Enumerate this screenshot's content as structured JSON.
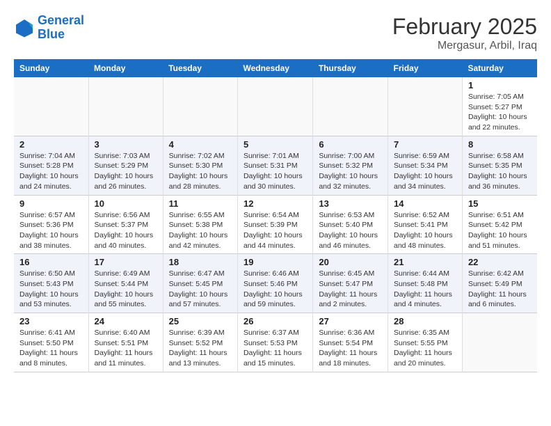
{
  "logo": {
    "line1": "General",
    "line2": "Blue"
  },
  "title": "February 2025",
  "subtitle": "Mergasur, Arbil, Iraq",
  "days_of_week": [
    "Sunday",
    "Monday",
    "Tuesday",
    "Wednesday",
    "Thursday",
    "Friday",
    "Saturday"
  ],
  "weeks": [
    [
      {
        "day": "",
        "info": ""
      },
      {
        "day": "",
        "info": ""
      },
      {
        "day": "",
        "info": ""
      },
      {
        "day": "",
        "info": ""
      },
      {
        "day": "",
        "info": ""
      },
      {
        "day": "",
        "info": ""
      },
      {
        "day": "1",
        "info": "Sunrise: 7:05 AM\nSunset: 5:27 PM\nDaylight: 10 hours and 22 minutes."
      }
    ],
    [
      {
        "day": "2",
        "info": "Sunrise: 7:04 AM\nSunset: 5:28 PM\nDaylight: 10 hours and 24 minutes."
      },
      {
        "day": "3",
        "info": "Sunrise: 7:03 AM\nSunset: 5:29 PM\nDaylight: 10 hours and 26 minutes."
      },
      {
        "day": "4",
        "info": "Sunrise: 7:02 AM\nSunset: 5:30 PM\nDaylight: 10 hours and 28 minutes."
      },
      {
        "day": "5",
        "info": "Sunrise: 7:01 AM\nSunset: 5:31 PM\nDaylight: 10 hours and 30 minutes."
      },
      {
        "day": "6",
        "info": "Sunrise: 7:00 AM\nSunset: 5:32 PM\nDaylight: 10 hours and 32 minutes."
      },
      {
        "day": "7",
        "info": "Sunrise: 6:59 AM\nSunset: 5:34 PM\nDaylight: 10 hours and 34 minutes."
      },
      {
        "day": "8",
        "info": "Sunrise: 6:58 AM\nSunset: 5:35 PM\nDaylight: 10 hours and 36 minutes."
      }
    ],
    [
      {
        "day": "9",
        "info": "Sunrise: 6:57 AM\nSunset: 5:36 PM\nDaylight: 10 hours and 38 minutes."
      },
      {
        "day": "10",
        "info": "Sunrise: 6:56 AM\nSunset: 5:37 PM\nDaylight: 10 hours and 40 minutes."
      },
      {
        "day": "11",
        "info": "Sunrise: 6:55 AM\nSunset: 5:38 PM\nDaylight: 10 hours and 42 minutes."
      },
      {
        "day": "12",
        "info": "Sunrise: 6:54 AM\nSunset: 5:39 PM\nDaylight: 10 hours and 44 minutes."
      },
      {
        "day": "13",
        "info": "Sunrise: 6:53 AM\nSunset: 5:40 PM\nDaylight: 10 hours and 46 minutes."
      },
      {
        "day": "14",
        "info": "Sunrise: 6:52 AM\nSunset: 5:41 PM\nDaylight: 10 hours and 48 minutes."
      },
      {
        "day": "15",
        "info": "Sunrise: 6:51 AM\nSunset: 5:42 PM\nDaylight: 10 hours and 51 minutes."
      }
    ],
    [
      {
        "day": "16",
        "info": "Sunrise: 6:50 AM\nSunset: 5:43 PM\nDaylight: 10 hours and 53 minutes."
      },
      {
        "day": "17",
        "info": "Sunrise: 6:49 AM\nSunset: 5:44 PM\nDaylight: 10 hours and 55 minutes."
      },
      {
        "day": "18",
        "info": "Sunrise: 6:47 AM\nSunset: 5:45 PM\nDaylight: 10 hours and 57 minutes."
      },
      {
        "day": "19",
        "info": "Sunrise: 6:46 AM\nSunset: 5:46 PM\nDaylight: 10 hours and 59 minutes."
      },
      {
        "day": "20",
        "info": "Sunrise: 6:45 AM\nSunset: 5:47 PM\nDaylight: 11 hours and 2 minutes."
      },
      {
        "day": "21",
        "info": "Sunrise: 6:44 AM\nSunset: 5:48 PM\nDaylight: 11 hours and 4 minutes."
      },
      {
        "day": "22",
        "info": "Sunrise: 6:42 AM\nSunset: 5:49 PM\nDaylight: 11 hours and 6 minutes."
      }
    ],
    [
      {
        "day": "23",
        "info": "Sunrise: 6:41 AM\nSunset: 5:50 PM\nDaylight: 11 hours and 8 minutes."
      },
      {
        "day": "24",
        "info": "Sunrise: 6:40 AM\nSunset: 5:51 PM\nDaylight: 11 hours and 11 minutes."
      },
      {
        "day": "25",
        "info": "Sunrise: 6:39 AM\nSunset: 5:52 PM\nDaylight: 11 hours and 13 minutes."
      },
      {
        "day": "26",
        "info": "Sunrise: 6:37 AM\nSunset: 5:53 PM\nDaylight: 11 hours and 15 minutes."
      },
      {
        "day": "27",
        "info": "Sunrise: 6:36 AM\nSunset: 5:54 PM\nDaylight: 11 hours and 18 minutes."
      },
      {
        "day": "28",
        "info": "Sunrise: 6:35 AM\nSunset: 5:55 PM\nDaylight: 11 hours and 20 minutes."
      },
      {
        "day": "",
        "info": ""
      }
    ]
  ]
}
